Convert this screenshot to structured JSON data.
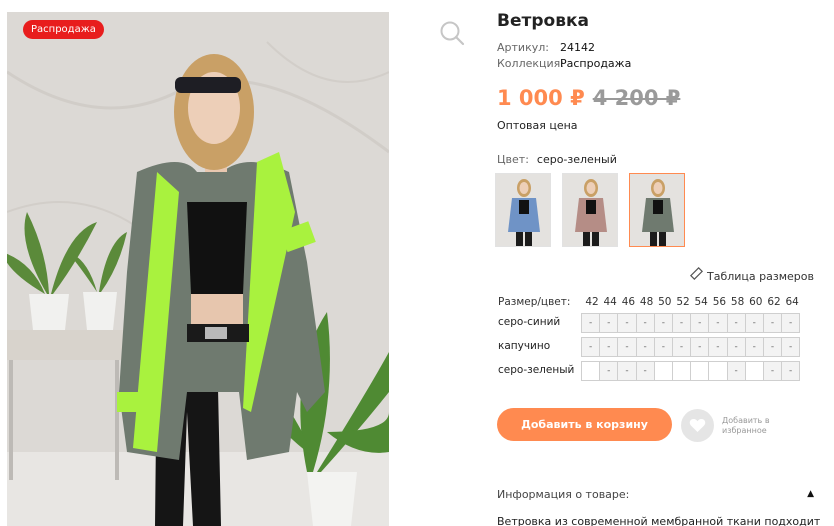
{
  "badge": "Распродажа",
  "product": {
    "title": "Ветровка",
    "article_label": "Артикул:",
    "article_value": "24142",
    "collection_label": "Коллекция:",
    "collection_value": "Распродажа",
    "price_new": "1 000 ₽",
    "price_old": "4 200 ₽",
    "price_note": "Оптовая цена"
  },
  "color": {
    "label": "Цвет:",
    "value": "серо-зеленый",
    "thumbs": [
      {
        "name": "серо-синий",
        "jacket": "#6f93c6",
        "selected": false
      },
      {
        "name": "капучино",
        "jacket": "#b58d86",
        "selected": false
      },
      {
        "name": "серо-зеленый",
        "jacket": "#6f7a6f",
        "selected": true
      }
    ]
  },
  "size_table_link": "Таблица размеров",
  "sizes": {
    "header_label": "Размер/цвет:",
    "sizes": [
      "42",
      "44",
      "46",
      "48",
      "50",
      "52",
      "54",
      "56",
      "58",
      "60",
      "62",
      "64"
    ],
    "rows": [
      {
        "label": "серо-синий",
        "cells": [
          "-",
          "-",
          "-",
          "-",
          "-",
          "-",
          "-",
          "-",
          "-",
          "-",
          "-",
          "-"
        ]
      },
      {
        "label": "капучино",
        "cells": [
          "-",
          "-",
          "-",
          "-",
          "-",
          "-",
          "-",
          "-",
          "-",
          "-",
          "-",
          "-"
        ]
      },
      {
        "label": "серо-зеленый",
        "cells": [
          "",
          "-",
          "-",
          "-",
          "",
          "",
          "",
          "",
          "-",
          "",
          "-",
          "-"
        ]
      }
    ]
  },
  "actions": {
    "add_to_cart": "Добавить в корзину",
    "add_to_favorites": "Добавить в избранное"
  },
  "info": {
    "heading": "Информация о товаре:",
    "text": "Ветровка  из современной мембранной ткани подходит"
  },
  "colors": {
    "accent": "#ff8a50",
    "sale_badge": "#e81d1d",
    "old_price": "#9a9a9a"
  }
}
